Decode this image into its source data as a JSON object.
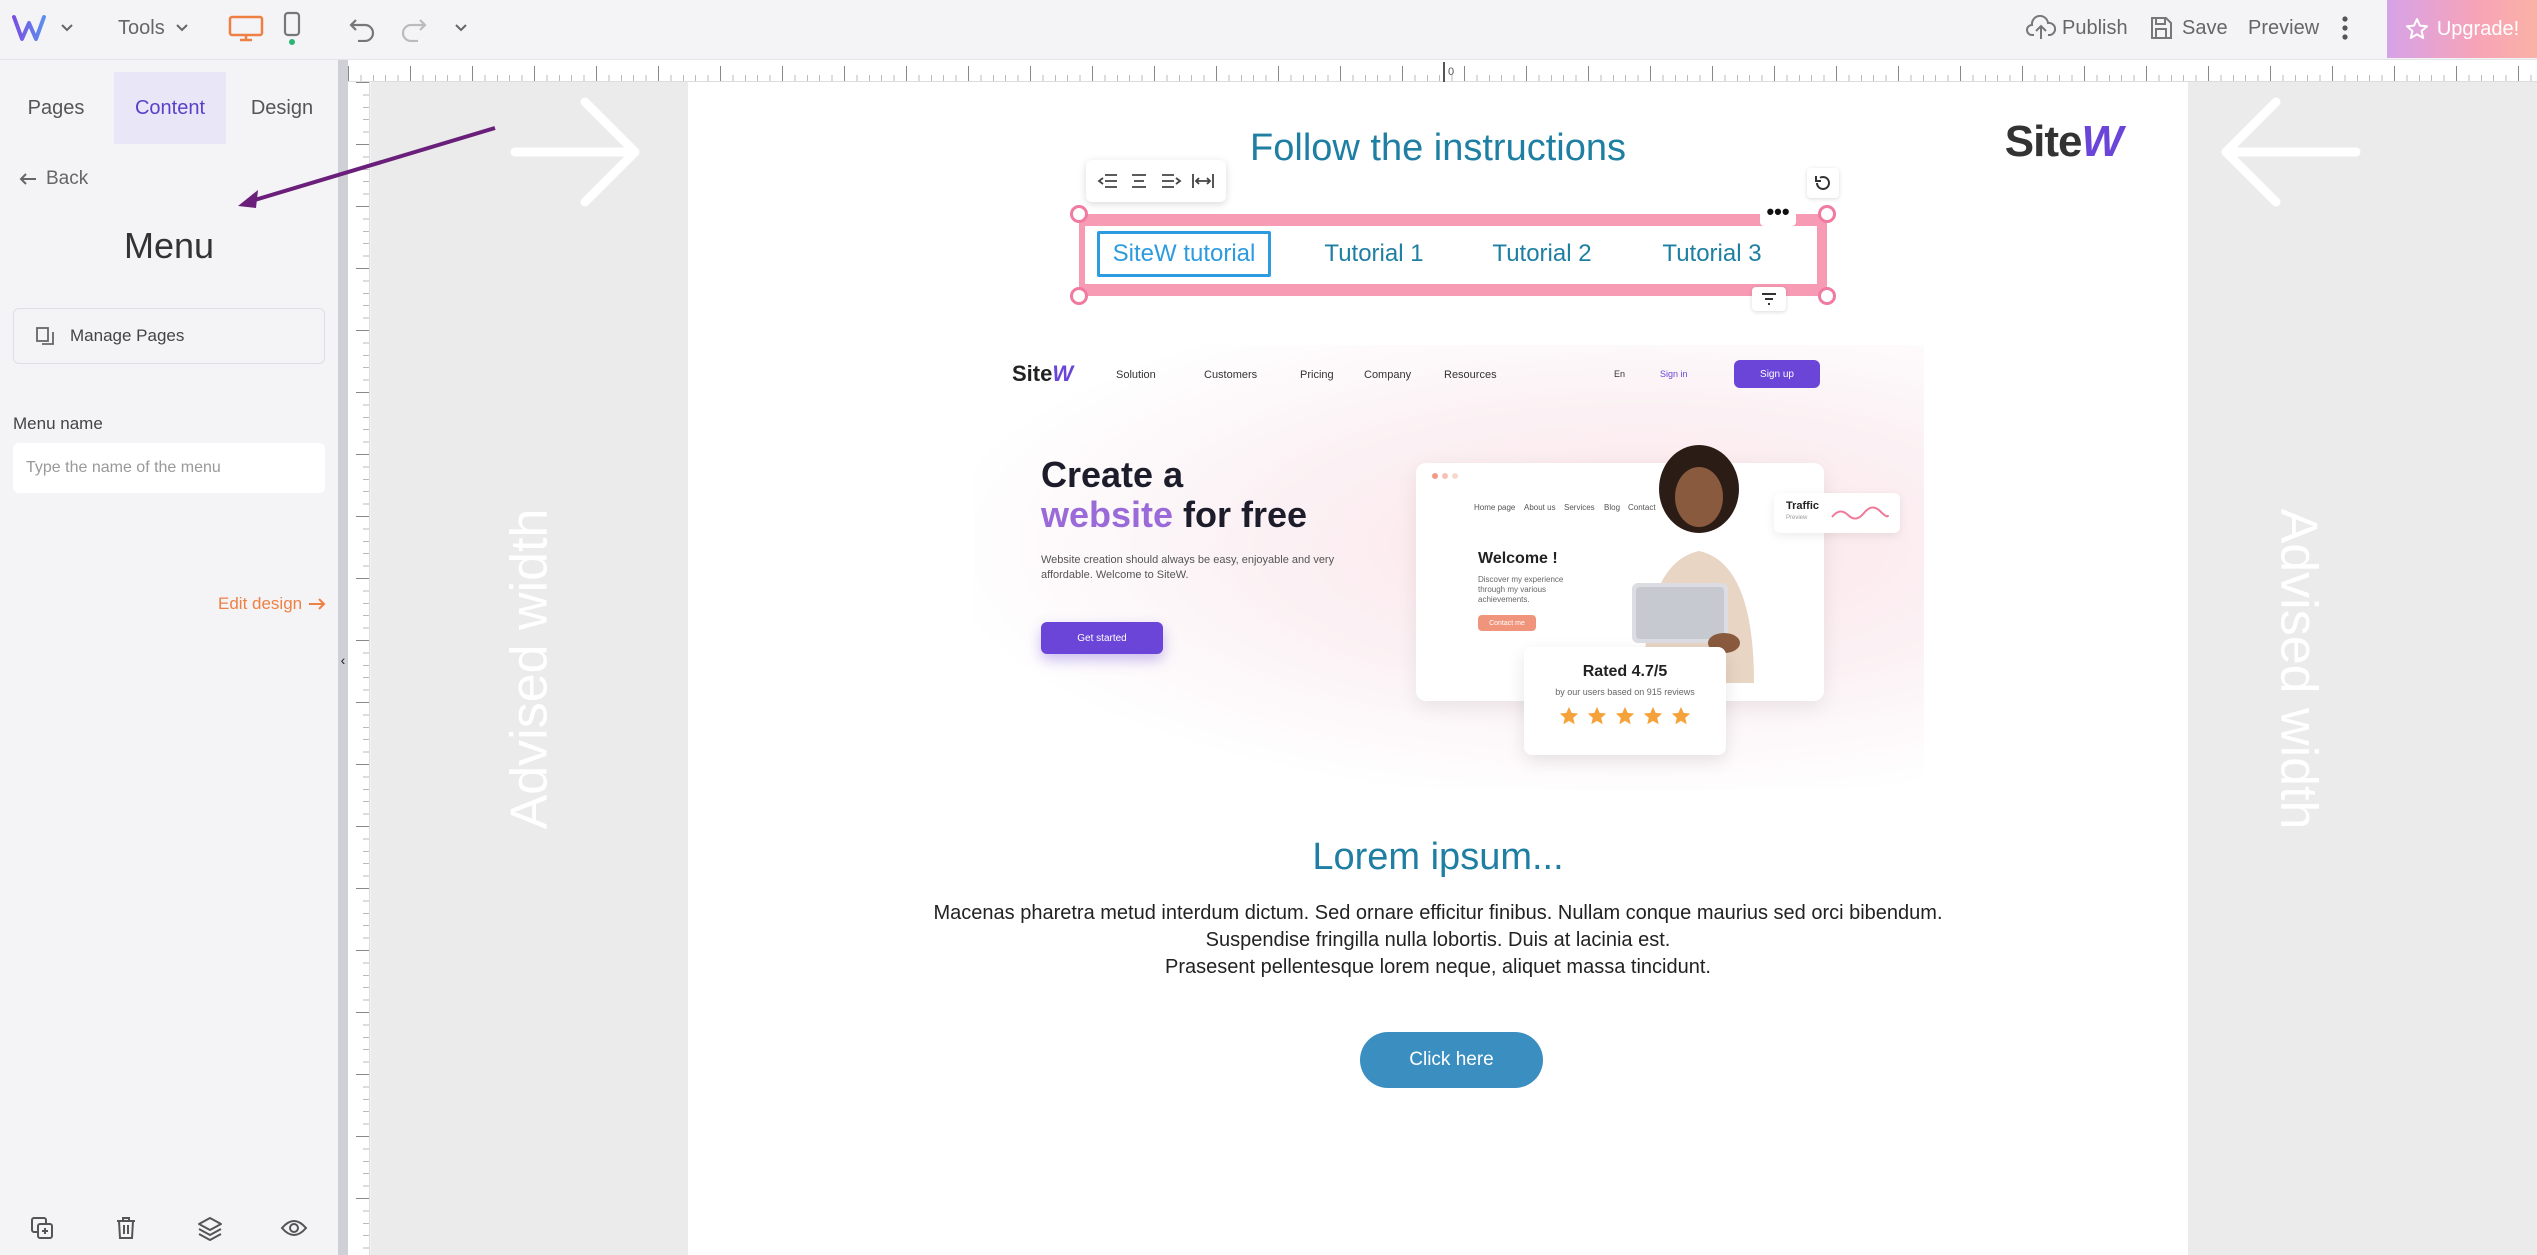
{
  "topbar": {
    "tools_label": "Tools",
    "publish_label": "Publish",
    "save_label": "Save",
    "preview_label": "Preview",
    "upgrade_label": "Upgrade!"
  },
  "panel": {
    "tabs": [
      {
        "label": "Pages"
      },
      {
        "label": "Content"
      },
      {
        "label": "Design"
      }
    ],
    "back_label": "Back",
    "title": "Menu",
    "manage_pages_label": "Manage Pages",
    "menu_name_label": "Menu name",
    "menu_name_placeholder": "Type the name of the menu",
    "menu_name_value": "",
    "edit_design_label": "Edit design"
  },
  "ruler": {
    "zero_label": "0"
  },
  "canvas": {
    "advised_width_label": "Advised width",
    "heading": "Follow the instructions",
    "logo": {
      "text": "Site",
      "accent": "W"
    },
    "menu_items": [
      {
        "label": "SiteW tutorial"
      },
      {
        "label": "Tutorial 1"
      },
      {
        "label": "Tutorial 2"
      },
      {
        "label": "Tutorial 3"
      }
    ],
    "more_label": "•••",
    "hero": {
      "logo": "Site",
      "logo_accent": "W",
      "nav": [
        "Solution",
        "Customers",
        "Pricing",
        "Company",
        "Resources"
      ],
      "lang": "En",
      "signin": "Sign in",
      "signup": "Sign up",
      "title_line1": "Create a",
      "title_word": "website",
      "title_rest": " for free",
      "subtitle": "Website creation should always be easy, enjoyable and very affordable. Welcome to SiteW.",
      "cta": "Get started",
      "mock_nav": [
        "Home page",
        "About us",
        "Services",
        "Blog",
        "Contact"
      ],
      "welcome": "Welcome !",
      "welcome_desc": "Discover my experience through my various achievements.",
      "contact_btn": "Contact me",
      "traffic": "Traffic",
      "traffic_sub": "Preview",
      "rating_title": "Rated 4.7/5",
      "rating_sub": "by our users based on 915 reviews"
    },
    "lorem_title": "Lorem ipsum...",
    "lorem_lines": [
      "Macenas pharetra metud interdum dictum. Sed ornare efficitur finibus. Nullam conque maurius sed orci bibendum.",
      "Suspendise fringilla nulla lobortis. Duis at lacinia est.",
      "Prasesent pellentesque lorem neque, aliquet massa tincidunt."
    ],
    "button_label": "Click here"
  },
  "colors": {
    "accent": "#5b3fc8",
    "heading": "#1e7fa3",
    "selection": "#f79ab4",
    "button": "#3a8fc0",
    "edit_design": "#ee8044"
  },
  "icons": [
    "logo-w-icon",
    "chevron-down-icon",
    "desktop-icon",
    "mobile-icon",
    "undo-icon",
    "redo-icon",
    "upload-icon",
    "save-icon",
    "more-vertical-icon",
    "star-icon",
    "arrow-left-icon",
    "copy-pages-icon",
    "arrow-right-icon",
    "duplicate-icon",
    "trash-icon",
    "layers-icon",
    "eye-icon",
    "align-left-icon",
    "align-center-icon",
    "align-right-icon",
    "justify-icon",
    "reset-icon",
    "filter-icon"
  ]
}
